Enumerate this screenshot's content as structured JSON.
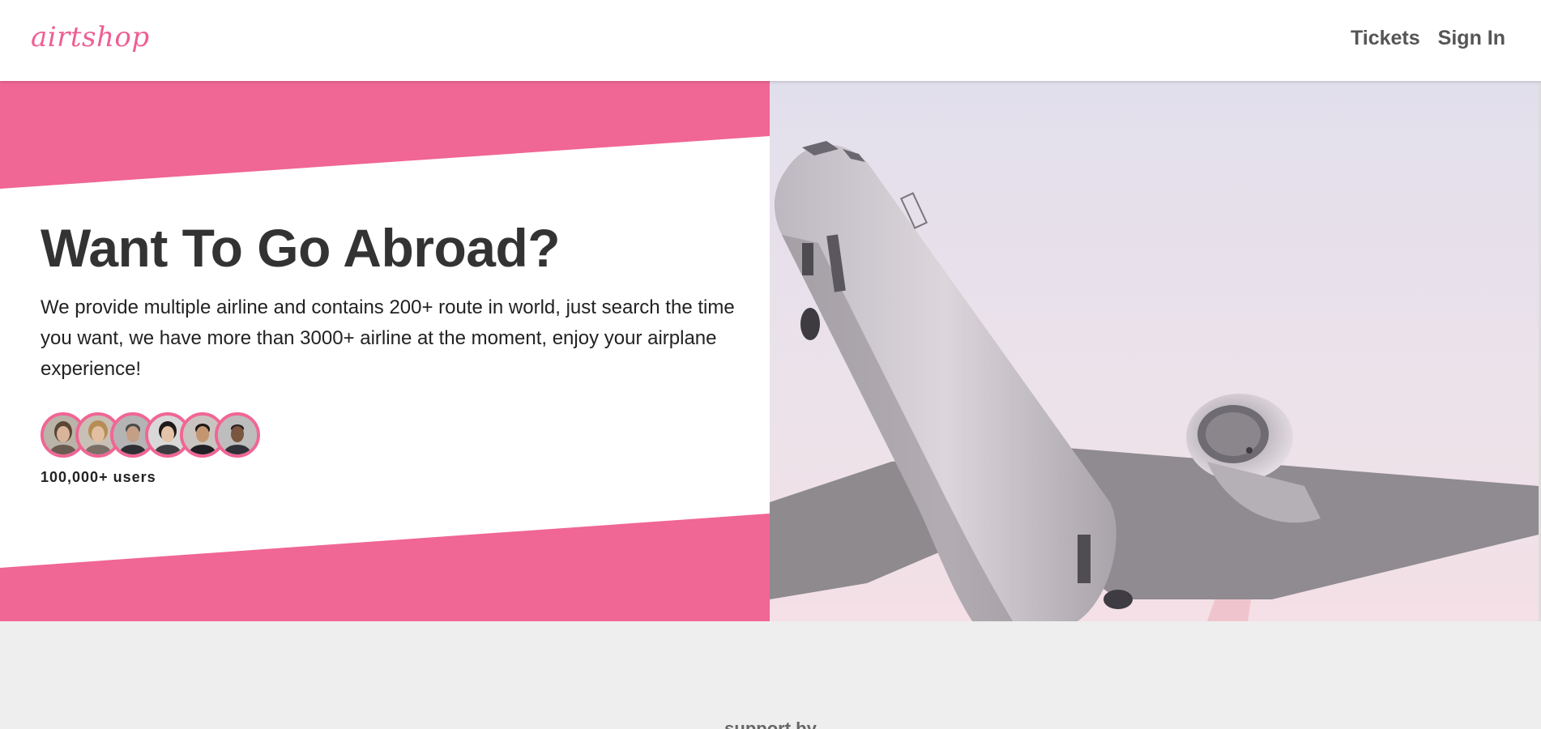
{
  "header": {
    "logo_text": "airtshop",
    "nav": [
      {
        "label": "Tickets"
      },
      {
        "label": "Sign In"
      }
    ]
  },
  "hero": {
    "title": "Want To Go Abroad?",
    "description": "We provide multiple airline and contains 200+ route in world, just search the time you want, we have more than 3000+ airline at the moment, enjoy your airplane experience!",
    "users_count": "100,000+ users",
    "avatar_count": 6,
    "accent_color": "#f06694"
  },
  "support": {
    "title": "support by"
  },
  "colors": {
    "brand": "#ee5f93",
    "accent": "#f06694",
    "text_dark": "#333333",
    "nav_text": "#555555",
    "background": "#eeeeee"
  }
}
